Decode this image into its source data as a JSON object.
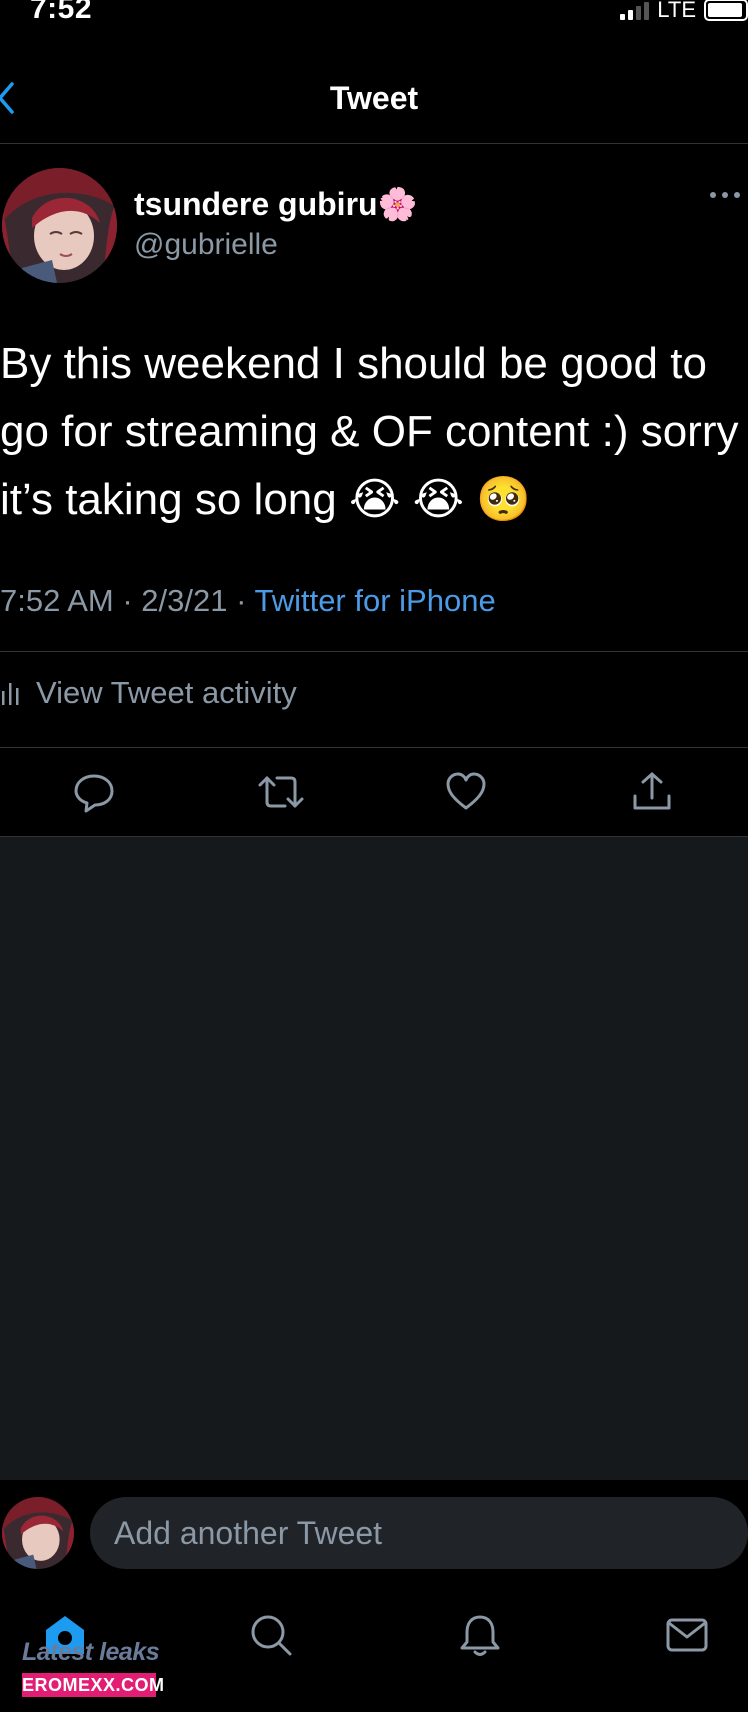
{
  "status_bar": {
    "time": "7:52",
    "network": "LTE"
  },
  "header": {
    "title": "Tweet"
  },
  "author": {
    "display_name": "tsundere gubiru",
    "name_emoji": "🌸",
    "handle": "@gubrielle"
  },
  "tweet": {
    "text": "By this weekend I should be good to go for streaming & OF content :) sorry it’s taking so long 😭 😭 🥺",
    "timestamp": "7:52 AM · 2/3/21 · ",
    "source": "Twitter for iPhone"
  },
  "activity": {
    "label": "View Tweet activity"
  },
  "reply": {
    "placeholder": "Add another Tweet"
  },
  "watermark": {
    "line1": "Latest leaks",
    "line2": "EROMEXX.COM"
  },
  "colors": {
    "background": "#000000",
    "link": "#4b9be6",
    "muted": "#8b98a5",
    "empty_area": "#16191c",
    "tab_active": "#1d9bf0"
  },
  "icons": {
    "back": "chevron-left-icon",
    "more": "more-horizontal-icon",
    "reply": "reply-bubble-icon",
    "retweet": "retweet-icon",
    "like": "heart-icon",
    "share": "share-icon",
    "home": "home-icon",
    "search": "search-icon",
    "notifications": "bell-icon",
    "messages": "mail-icon"
  }
}
